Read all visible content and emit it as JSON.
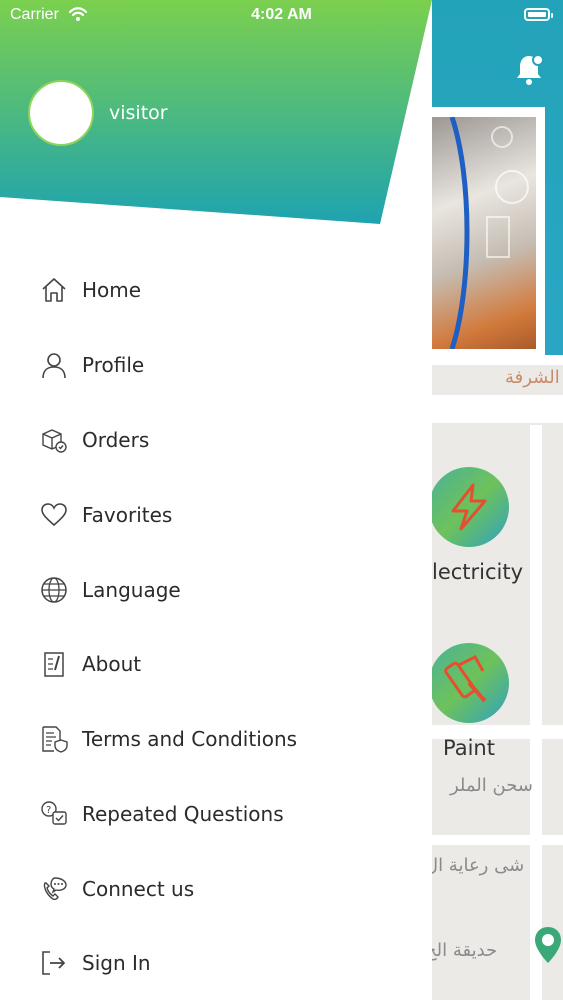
{
  "status_bar": {
    "carrier": "Carrier",
    "time": "4:02 AM"
  },
  "drawer": {
    "user_name": "visitor",
    "menu": [
      {
        "label": "Home",
        "icon": "home-icon"
      },
      {
        "label": "Profile",
        "icon": "profile-icon"
      },
      {
        "label": "Orders",
        "icon": "orders-icon"
      },
      {
        "label": "Favorites",
        "icon": "heart-icon"
      },
      {
        "label": "Language",
        "icon": "globe-icon"
      },
      {
        "label": "About",
        "icon": "notepad-icon"
      },
      {
        "label": "Terms and Conditions",
        "icon": "document-shield-icon"
      },
      {
        "label": "Repeated Questions",
        "icon": "question-chat-icon"
      },
      {
        "label": "Connect us",
        "icon": "phone-chat-icon"
      },
      {
        "label": "Sign In",
        "icon": "sign-in-icon"
      }
    ]
  },
  "background": {
    "categories": [
      {
        "label": "lectricity",
        "icon": "lightning-icon"
      },
      {
        "label": "Paint",
        "icon": "paint-roller-icon"
      }
    ],
    "map_labels": [
      "الشرفة",
      "سحن الملر",
      "شى رعاية ال",
      "حديقة الح"
    ]
  },
  "colors": {
    "header_gradient_start": "#7bd04e",
    "header_gradient_end": "#1ea3b0",
    "accent": "#2aa6c4",
    "icon_red": "#e4502f"
  }
}
